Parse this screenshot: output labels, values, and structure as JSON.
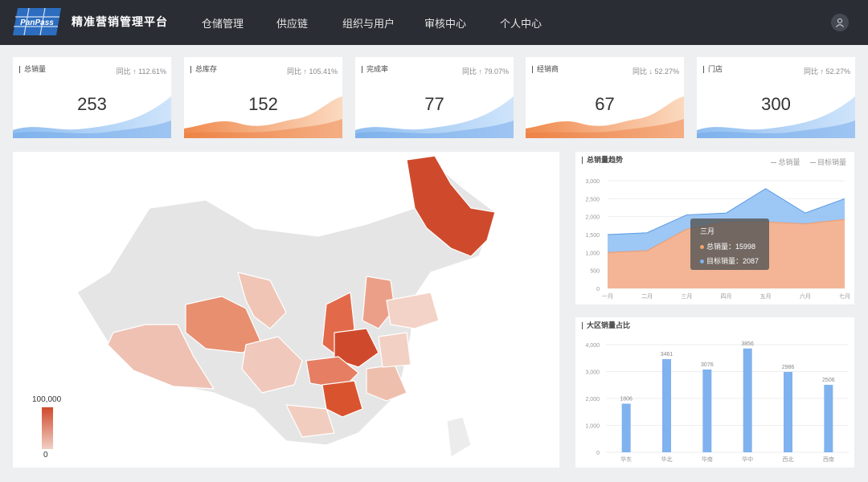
{
  "header": {
    "brand": "精准营销管理平台",
    "logo_text": "PanPass",
    "nav": [
      "仓储管理",
      "供应链",
      "组织与用户",
      "审核中心",
      "个人中心"
    ]
  },
  "kpis": [
    {
      "title": "总销量",
      "yoy": "同比 ↑ 112.61%",
      "value": "253"
    },
    {
      "title": "总库存",
      "yoy": "同比 ↑ 105.41%",
      "value": "152"
    },
    {
      "title": "完成率",
      "yoy": "同比 ↑ 79.07%",
      "value": "77"
    },
    {
      "title": "经销商",
      "yoy": "同比 ↓ 52.27%",
      "value": "67"
    },
    {
      "title": "门店",
      "yoy": "同比 ↑ 52.27%",
      "value": "300"
    }
  ],
  "map": {
    "legend_max": "100,000",
    "legend_min": "0"
  },
  "colors": {
    "topbar": "#2a2d33",
    "wave_blue": "#9fc7f2",
    "wave_orange": "#f2a36c",
    "map_dark": "#cf4a2c",
    "map_mid": "#e48a6e",
    "map_light": "#efc1b3",
    "map_none": "#e6e6e6",
    "bar": "#7fb2ef"
  },
  "trend": {
    "title": "总销量趋势",
    "legend": [
      "总销量",
      "目标销量"
    ],
    "tooltip": {
      "month": "三月",
      "row1": "总销量：15998",
      "row2": "目标销量：2087"
    }
  },
  "region": {
    "title": "大区销量占比"
  },
  "chart_data": [
    {
      "type": "area",
      "title": "总销量趋势",
      "categories": [
        "一月",
        "二月",
        "三月",
        "四月",
        "五月",
        "六月",
        "七月"
      ],
      "series": [
        {
          "name": "总销量",
          "values": [
            1500,
            1550,
            2050,
            2100,
            2780,
            2100,
            2500
          ]
        },
        {
          "name": "目标销量",
          "values": [
            1000,
            1050,
            1650,
            1850,
            1850,
            1800,
            1920
          ]
        }
      ],
      "y_ticks": [
        "0",
        "500",
        "1,000",
        "1,500",
        "2,000",
        "2,500",
        "3,000"
      ],
      "ylim": [
        0,
        3000
      ],
      "grid": true,
      "legend_position": "top-right"
    },
    {
      "type": "bar",
      "title": "大区销量占比",
      "categories": [
        "华东",
        "华北",
        "华南",
        "华中",
        "西北",
        "西南"
      ],
      "values": [
        1806,
        3461,
        3076,
        3856,
        2986,
        2506
      ],
      "y_ticks": [
        "0",
        "1,000",
        "2,000",
        "3,000",
        "4,000"
      ],
      "ylim": [
        0,
        4000
      ],
      "grid": true
    }
  ]
}
